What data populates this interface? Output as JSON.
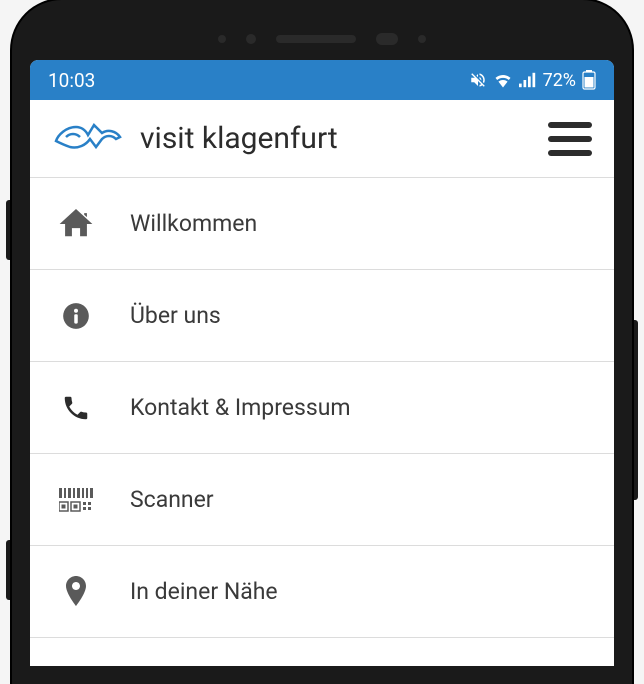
{
  "status_bar": {
    "time": "10:03",
    "battery_percent": "72%"
  },
  "header": {
    "app_title": "visit klagenfurt"
  },
  "menu": {
    "items": [
      {
        "icon": "home",
        "label": "Willkommen"
      },
      {
        "icon": "info",
        "label": "Über uns"
      },
      {
        "icon": "phone",
        "label": "Kontakt & Impressum"
      },
      {
        "icon": "barcode",
        "label": "Scanner"
      },
      {
        "icon": "location",
        "label": "In deiner Nähe"
      }
    ]
  }
}
